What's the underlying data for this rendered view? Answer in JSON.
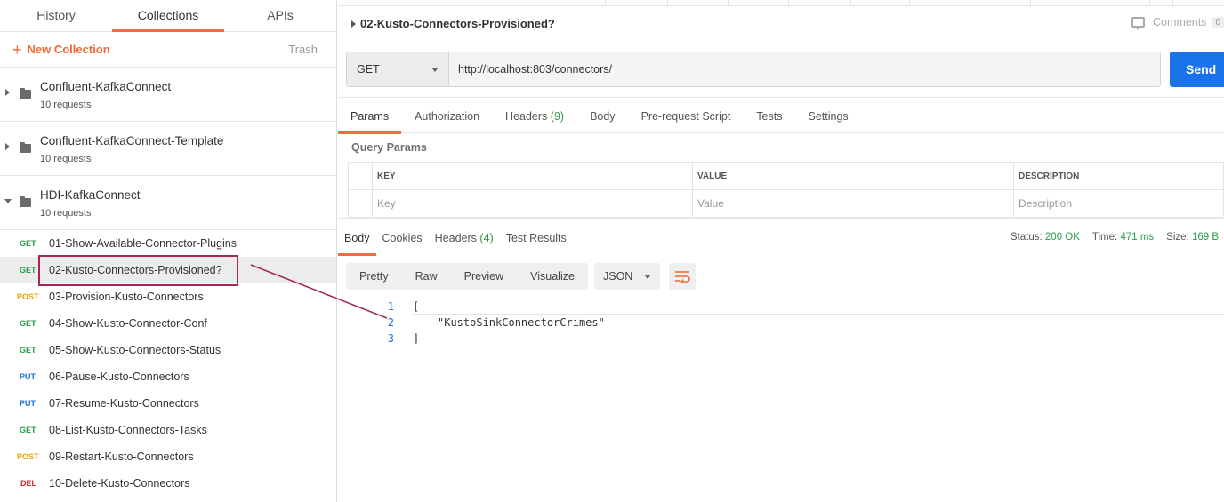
{
  "sidebar": {
    "tabs": [
      {
        "label": "History"
      },
      {
        "label": "Collections"
      },
      {
        "label": "APIs"
      }
    ],
    "active_tab": "Collections",
    "new_collection_label": "New Collection",
    "trash_label": "Trash",
    "collections": [
      {
        "name": "Confluent-KafkaConnect",
        "count": "10 requests",
        "expanded": false
      },
      {
        "name": "Confluent-KafkaConnect-Template",
        "count": "10 requests",
        "expanded": false
      },
      {
        "name": "HDI-KafkaConnect",
        "count": "10 requests",
        "expanded": true
      }
    ],
    "requests": [
      {
        "method": "GET",
        "name": "01-Show-Available-Connector-Plugins"
      },
      {
        "method": "GET",
        "name": "02-Kusto-Connectors-Provisioned?"
      },
      {
        "method": "POST",
        "name": "03-Provision-Kusto-Connectors"
      },
      {
        "method": "GET",
        "name": "04-Show-Kusto-Connector-Conf"
      },
      {
        "method": "GET",
        "name": "05-Show-Kusto-Connectors-Status"
      },
      {
        "method": "PUT",
        "name": "06-Pause-Kusto-Connectors"
      },
      {
        "method": "PUT",
        "name": "07-Resume-Kusto-Connectors"
      },
      {
        "method": "GET",
        "name": "08-List-Kusto-Connectors-Tasks"
      },
      {
        "method": "POST",
        "name": "09-Restart-Kusto-Connectors"
      },
      {
        "method": "DEL",
        "name": "10-Delete-Kusto-Connectors"
      }
    ],
    "selected_request": "02-Kusto-Connectors-Provisioned?"
  },
  "request": {
    "title": "02-Kusto-Connectors-Provisioned?",
    "comments_label": "Comments",
    "comments_count": "0",
    "method": "GET",
    "url": "http://localhost:803/connectors/",
    "send_label": "Send",
    "tabs": {
      "params": "Params",
      "authorization": "Authorization",
      "headers": "Headers",
      "headers_count": "(9)",
      "body": "Body",
      "prerequest": "Pre-request Script",
      "tests": "Tests",
      "settings": "Settings"
    },
    "query_params_label": "Query Params",
    "table": {
      "key_header": "KEY",
      "value_header": "VALUE",
      "description_header": "DESCRIPTION",
      "key_placeholder": "Key",
      "value_placeholder": "Value",
      "description_placeholder": "Description"
    }
  },
  "response": {
    "tabs": {
      "body": "Body",
      "cookies": "Cookies",
      "headers": "Headers",
      "headers_count": "(4)",
      "test_results": "Test Results"
    },
    "status_label": "Status:",
    "status_value": "200 OK",
    "time_label": "Time:",
    "time_value": "471 ms",
    "size_label": "Size:",
    "size_value": "169 B",
    "views": {
      "pretty": "Pretty",
      "raw": "Raw",
      "preview": "Preview",
      "visualize": "Visualize"
    },
    "format": "JSON",
    "code_lines": [
      {
        "num": "1",
        "text": "["
      },
      {
        "num": "2",
        "text": "\"KustoSinkConnectorCrimes\""
      },
      {
        "num": "3",
        "text": "]"
      }
    ]
  },
  "colors": {
    "accent": "#f26b3a",
    "send": "#1a73e8",
    "get": "#2a9a48",
    "post": "#f0a300",
    "put": "#1a6fd6",
    "del": "#d3252a",
    "annotation": "#a3275a"
  }
}
